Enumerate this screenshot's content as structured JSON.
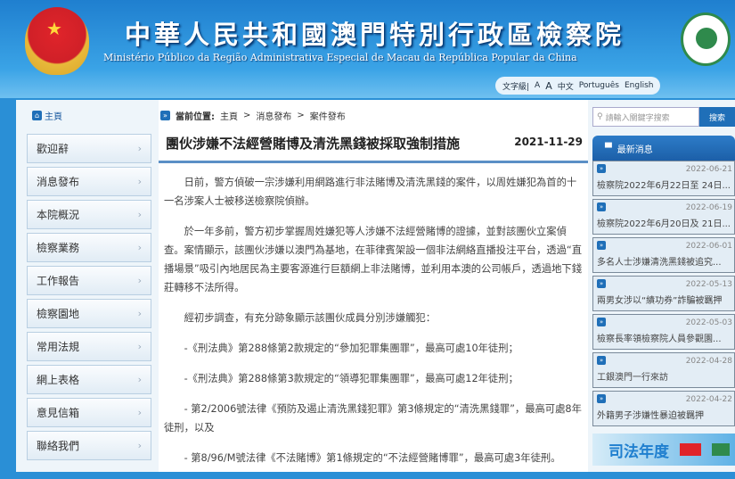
{
  "header": {
    "title_cn": "中華人民共和國澳門特別行政區檢察院",
    "title_pt": "Ministério Público da Região Administrativa Especial de Macau da República Popular da China",
    "lang_bar": [
      "文字級|",
      "A",
      "A",
      "中文",
      "Português",
      "English"
    ]
  },
  "home": "主頁",
  "sidebar": [
    "歡迎辭",
    "消息發布",
    "本院概況",
    "檢察業務",
    "工作報告",
    "檢察園地",
    "常用法規",
    "網上表格",
    "意見信箱",
    "聯絡我們"
  ],
  "breadcrumb": {
    "label": "當前位置:",
    "items": [
      "主頁",
      ">",
      "消息發布",
      ">",
      "案件發布"
    ]
  },
  "article": {
    "title": "團伙涉嫌不法經營賭博及清洗黑錢被採取強制措施",
    "date": "2021-11-29",
    "paragraphs": [
      "日前，警方偵破一宗涉嫌利用網路進行非法賭博及清洗黑錢的案件，以周姓嫌犯為首的十一名涉案人士被移送檢察院偵辦。",
      "於一年多前，警方初步掌握周姓嫌犯等人涉嫌不法經營賭博的證據，並對該團伙立案偵查。案情顯示，該團伙涉嫌以澳門為基地，在菲律賓架設一個非法網絡直播投注平台，透過“直播場景”吸引內地居民為主要客源進行巨額網上非法賭博，並利用本澳的公司帳戶，透過地下錢莊轉移不法所得。",
      "經初步調查，有充分跡象顯示該團伙成員分別涉嫌觸犯：",
      "-《刑法典》第288條第2款規定的“參加犯罪集團罪”，最高可處10年徒刑；",
      "-《刑法典》第288條第3款規定的“領導犯罪集團罪”，最高可處12年徒刑；",
      "- 第2/2006號法律《預防及遏止清洗黑錢犯罪》第3條規定的“清洗黑錢罪”，最高可處8年徒刑，以及",
      "- 第8/96/M號法律《不法賭博》第1條規定的“不法經營賭博罪”，最高可處3年徒刑。"
    ]
  },
  "search": {
    "placeholder": "請輸入關鍵字搜索",
    "button": "搜索"
  },
  "news": {
    "header": "最新消息",
    "items": [
      {
        "date": "2022-06-21",
        "title": "檢察院2022年6月22日至 24日..."
      },
      {
        "date": "2022-06-19",
        "title": "檢察院2022年6月20日及 21日..."
      },
      {
        "date": "2022-06-01",
        "title": "多名人士涉嫌清洗黑錢被追究..."
      },
      {
        "date": "2022-05-13",
        "title": "兩男女涉以“績功券”詐騙被羈押"
      },
      {
        "date": "2022-05-03",
        "title": "檢察長率領檢察院人員參觀園..."
      },
      {
        "date": "2022-04-28",
        "title": "工銀澳門一行來訪"
      },
      {
        "date": "2022-04-22",
        "title": "外籍男子涉嫌性暴迫被羈押"
      }
    ]
  },
  "banner": "司法年度"
}
